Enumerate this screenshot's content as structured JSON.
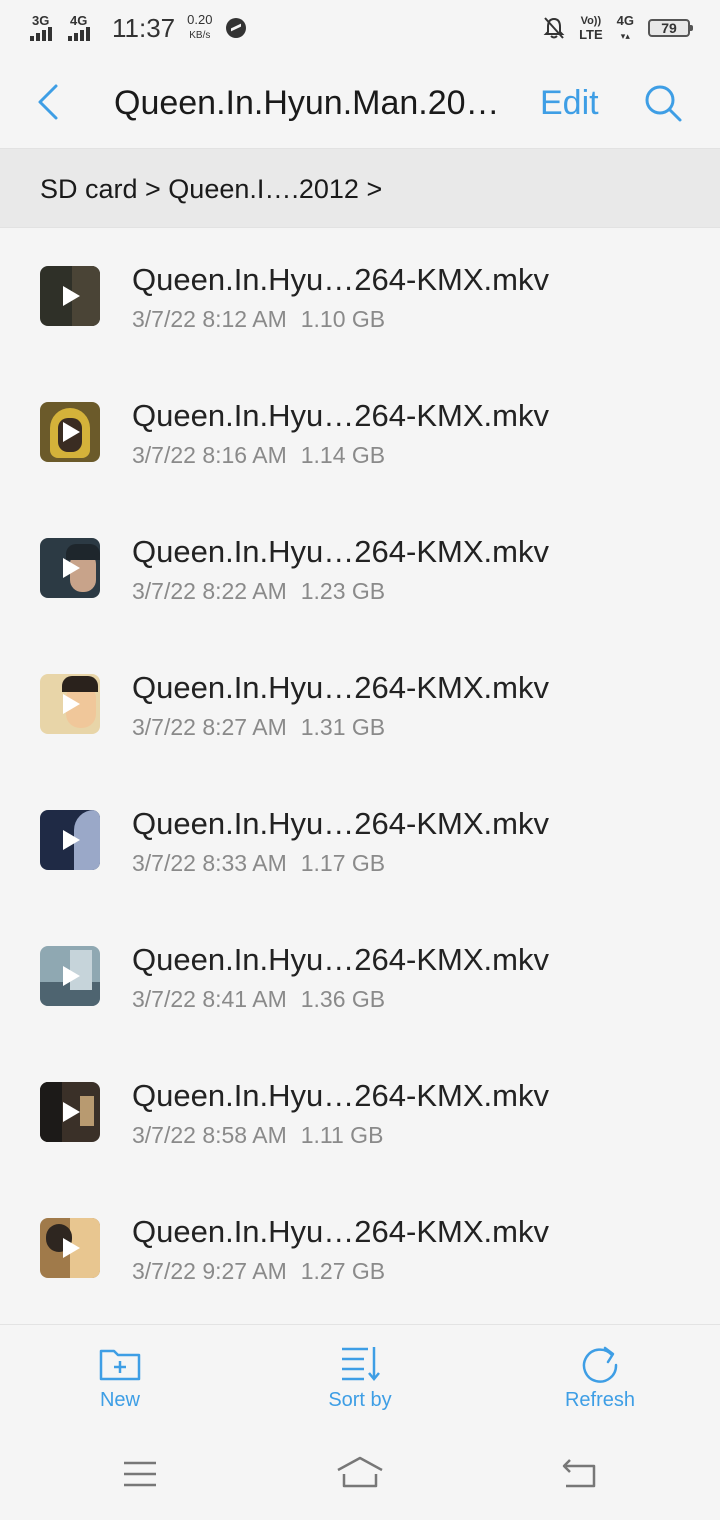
{
  "status_bar": {
    "network_1": "3G",
    "network_2": "4G",
    "time": "11:37",
    "speed_value": "0.20",
    "speed_unit": "KB/s",
    "volte_top": "Vo))",
    "volte_bottom": "LTE",
    "lte_label": "4G",
    "battery": "79"
  },
  "header": {
    "title": "Queen.In.Hyun.Man.20…",
    "edit_label": "Edit"
  },
  "breadcrumb": {
    "path": "SD card > Queen.I….2012 >"
  },
  "files": [
    {
      "name": "Queen.In.Hyu…264-KMX.mkv",
      "date": "3/7/22 8:12 AM",
      "size": "1.10 GB",
      "thumb_color": "#2f3028"
    },
    {
      "name": "Queen.In.Hyu…264-KMX.mkv",
      "date": "3/7/22 8:16 AM",
      "size": "1.14 GB",
      "thumb_color": "#6b5a2a"
    },
    {
      "name": "Queen.In.Hyu…264-KMX.mkv",
      "date": "3/7/22 8:22 AM",
      "size": "1.23 GB",
      "thumb_color": "#2c3a44"
    },
    {
      "name": "Queen.In.Hyu…264-KMX.mkv",
      "date": "3/7/22 8:27 AM",
      "size": "1.31 GB",
      "thumb_color": "#e8d5a8"
    },
    {
      "name": "Queen.In.Hyu…264-KMX.mkv",
      "date": "3/7/22 8:33 AM",
      "size": "1.17 GB",
      "thumb_color": "#1f2a45"
    },
    {
      "name": "Queen.In.Hyu…264-KMX.mkv",
      "date": "3/7/22 8:41 AM",
      "size": "1.36 GB",
      "thumb_color": "#8fa8b2"
    },
    {
      "name": "Queen.In.Hyu…264-KMX.mkv",
      "date": "3/7/22 8:58 AM",
      "size": "1.11 GB",
      "thumb_color": "#3a3028"
    },
    {
      "name": "Queen.In.Hyu…264-KMX.mkv",
      "date": "3/7/22 9:27 AM",
      "size": "1.27 GB",
      "thumb_color": "#a07a4a"
    }
  ],
  "toolbar": {
    "new_label": "New",
    "sort_label": "Sort by",
    "refresh_label": "Refresh"
  },
  "colors": {
    "accent": "#3e9ee5",
    "background": "#f5f5f5",
    "breadcrumb_bg": "#e9e9e9",
    "meta_text": "#8a8a8a"
  },
  "icons": {
    "back": "chevron-left-icon",
    "search": "search-icon",
    "new": "new-folder-icon",
    "sort": "sort-icon",
    "refresh": "refresh-icon",
    "menu": "menu-icon",
    "home": "home-icon",
    "nav_back": "back-icon"
  }
}
